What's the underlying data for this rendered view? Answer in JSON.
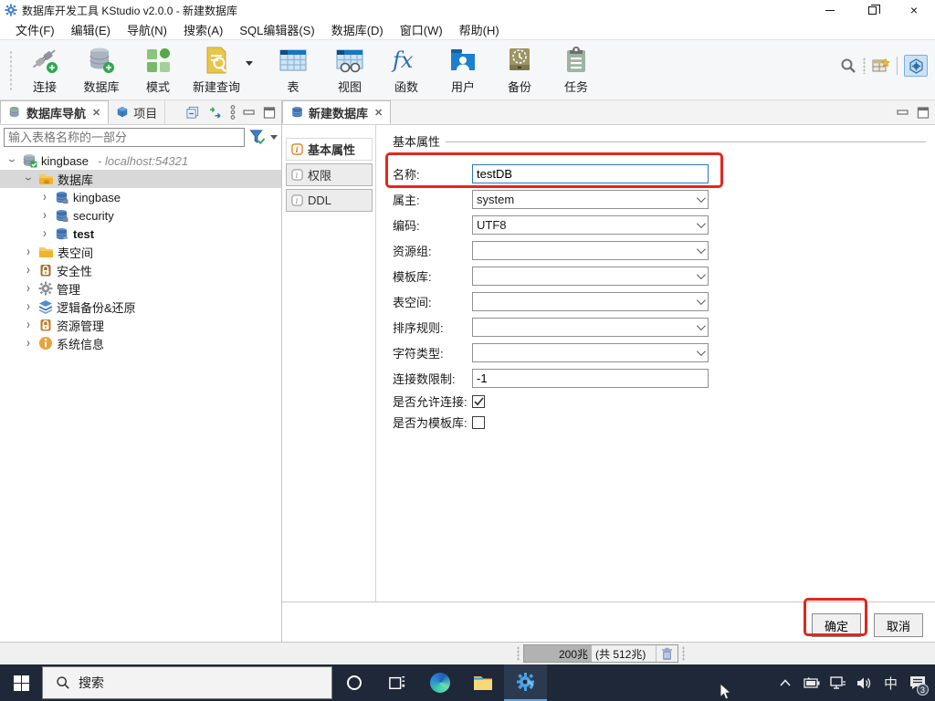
{
  "window": {
    "title": "数据库开发工具 KStudio v2.0.0 - 新建数据库"
  },
  "menubar": {
    "items": [
      "文件(F)",
      "编辑(E)",
      "导航(N)",
      "搜索(A)",
      "SQL编辑器(S)",
      "数据库(D)",
      "窗口(W)",
      "帮助(H)"
    ]
  },
  "toolbar": {
    "items": [
      {
        "label": "连接",
        "icon": "connection-new-icon"
      },
      {
        "label": "数据库",
        "icon": "database-new-icon"
      },
      {
        "label": "模式",
        "icon": "schema-icon"
      },
      {
        "label": "新建查询",
        "icon": "new-query-icon"
      },
      {
        "label": "表",
        "icon": "table-icon"
      },
      {
        "label": "视图",
        "icon": "view-icon"
      },
      {
        "label": "函数",
        "icon": "function-icon"
      },
      {
        "label": "用户",
        "icon": "user-icon"
      },
      {
        "label": "备份",
        "icon": "backup-icon"
      },
      {
        "label": "任务",
        "icon": "task-icon"
      }
    ]
  },
  "navigator": {
    "tabs": [
      {
        "label": "数据库导航",
        "active": true
      },
      {
        "label": "项目",
        "active": false
      }
    ],
    "filter_placeholder": "输入表格名称的一部分",
    "tree": {
      "items": [
        {
          "label": "kingbase",
          "suffix": "- localhost:54321"
        },
        {
          "label": "数据库"
        },
        {
          "label": "kingbase"
        },
        {
          "label": "security"
        },
        {
          "label": "test"
        },
        {
          "label": "表空间"
        },
        {
          "label": "安全性"
        },
        {
          "label": "管理"
        },
        {
          "label": "逻辑备份&还原"
        },
        {
          "label": "资源管理"
        },
        {
          "label": "系统信息"
        }
      ]
    }
  },
  "editor": {
    "tab": "新建数据库",
    "side_tabs": [
      {
        "label": "基本属性",
        "active": true
      },
      {
        "label": "权限",
        "active": false
      },
      {
        "label": "DDL",
        "active": false
      }
    ],
    "group_title": "基本属性",
    "fields": [
      {
        "label": "名称:",
        "value": "testDB",
        "type": "text"
      },
      {
        "label": "属主:",
        "value": "system",
        "type": "select"
      },
      {
        "label": "编码:",
        "value": "UTF8",
        "type": "select"
      },
      {
        "label": "资源组:",
        "value": "",
        "type": "select"
      },
      {
        "label": "模板库:",
        "value": "",
        "type": "select"
      },
      {
        "label": "表空间:",
        "value": "",
        "type": "select"
      },
      {
        "label": "排序规则:",
        "value": "",
        "type": "select"
      },
      {
        "label": "字符类型:",
        "value": "",
        "type": "select"
      },
      {
        "label": "连接数限制:",
        "value": "-1",
        "type": "text"
      },
      {
        "label": "是否允许连接:",
        "checked": true,
        "type": "checkbox"
      },
      {
        "label": "是否为模板库:",
        "checked": false,
        "type": "checkbox"
      }
    ],
    "buttons": {
      "ok": "确定",
      "cancel": "取消"
    }
  },
  "statusbar": {
    "heap_used": "200兆",
    "heap_total": "(共 512兆)"
  },
  "taskbar": {
    "search_placeholder": "搜索",
    "ime_indicator": "中",
    "notification_count": "3"
  },
  "colors": {
    "annotation": "#e2271c",
    "selection": "#d8d8d8",
    "accent_blue": "#2a79c9",
    "taskbar": "#1e2838"
  }
}
